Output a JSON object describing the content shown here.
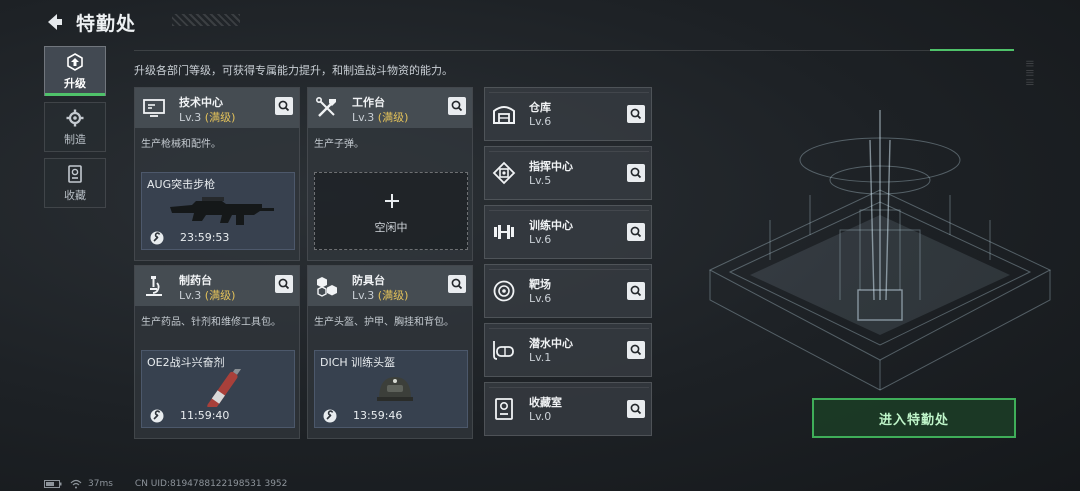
{
  "header": {
    "title": "特勤处"
  },
  "sidebar": {
    "tabs": [
      {
        "label": "升级",
        "active": true,
        "icon": "upgrade-icon"
      },
      {
        "label": "制造",
        "active": false,
        "icon": "gear-icon"
      },
      {
        "label": "收藏",
        "active": false,
        "icon": "collection-icon"
      }
    ]
  },
  "description": "升级各部门等级，可获得专属能力提升，和制造战斗物资的能力。",
  "workshops": [
    {
      "name": "技术中心",
      "level": "Lv.3",
      "max_tag": "(满级)",
      "desc": "生产枪械和配件。",
      "icon": "monitor-icon",
      "production": {
        "item": "AUG突击步枪",
        "timer": "23:59:53",
        "item_icon": "rifle-icon"
      }
    },
    {
      "name": "工作台",
      "level": "Lv.3",
      "max_tag": "(满级)",
      "desc": "生产子弹。",
      "icon": "tools-icon",
      "idle_label": "空闲中"
    },
    {
      "name": "制药台",
      "level": "Lv.3",
      "max_tag": "(满级)",
      "desc": "生产药品、针剂和维修工具包。",
      "icon": "microscope-icon",
      "production": {
        "item": "OE2战斗兴奋剂",
        "timer": "11:59:40",
        "item_icon": "injector-icon"
      }
    },
    {
      "name": "防具台",
      "level": "Lv.3",
      "max_tag": "(满级)",
      "desc": "生产头盔、护甲、胸挂和背包。",
      "icon": "cubes-icon",
      "production": {
        "item": "DICH 训练头盔",
        "timer": "13:59:46",
        "item_icon": "helmet-icon"
      }
    }
  ],
  "rooms": [
    {
      "name": "仓库",
      "level": "Lv.6",
      "icon": "warehouse-icon"
    },
    {
      "name": "指挥中心",
      "level": "Lv.5",
      "icon": "chip-icon"
    },
    {
      "name": "训练中心",
      "level": "Lv.6",
      "icon": "dumbbell-icon"
    },
    {
      "name": "靶场",
      "level": "Lv.6",
      "icon": "target-icon"
    },
    {
      "name": "潜水中心",
      "level": "Lv.1",
      "icon": "diving-mask-icon"
    },
    {
      "name": "收藏室",
      "level": "Lv.0",
      "icon": "trophy-icon"
    }
  ],
  "enter_button": "进入特勤处",
  "status_bar": {
    "ping": "37ms",
    "uid": "CN UID:8194788122198531 3952"
  },
  "colors": {
    "accent_green": "#4fc26a",
    "max_level": "#e2c15a",
    "production_bg": "#3a4454"
  }
}
